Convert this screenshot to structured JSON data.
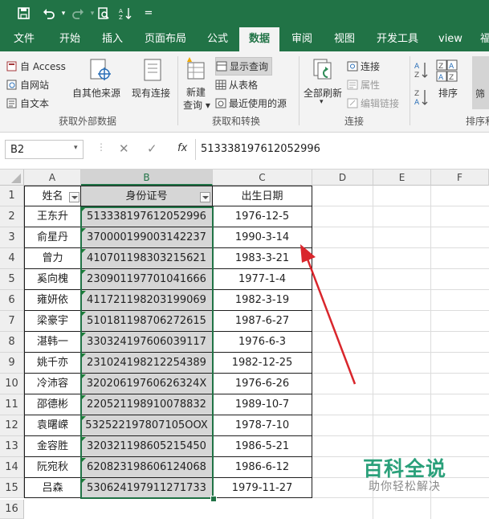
{
  "quick_access": {
    "qa_more": "="
  },
  "tabs": [
    {
      "label": "文件"
    },
    {
      "label": "开始"
    },
    {
      "label": "插入"
    },
    {
      "label": "页面布局"
    },
    {
      "label": "公式"
    },
    {
      "label": "数据"
    },
    {
      "label": "审阅"
    },
    {
      "label": "视图"
    },
    {
      "label": "开发工具"
    },
    {
      "label": "view"
    },
    {
      "label": "福"
    }
  ],
  "active_tab": "数据",
  "ribbon": {
    "get_external": {
      "from_access": "自 Access",
      "from_web": "自网站",
      "from_text": "自文本",
      "from_other": "自其他来源",
      "existing": "现有连接",
      "group_label": "获取外部数据"
    },
    "get_transform": {
      "new_query_1": "新建",
      "new_query_2": "查询",
      "show_queries": "显示查询",
      "from_table": "从表格",
      "recent_sources": "最近使用的源",
      "group_label": "获取和转换"
    },
    "connections": {
      "refresh_all": "全部刷新",
      "connections": "连接",
      "properties": "属性",
      "edit_links": "编辑链接",
      "group_label": "连接"
    },
    "sort_filter": {
      "sort": "排序",
      "filter": "筛",
      "group_label": "排序和"
    }
  },
  "formula_bar": {
    "name_box": "B2",
    "cancel": "✕",
    "enter": "✓",
    "fx": "fx",
    "value": "513338197612052996"
  },
  "columns": [
    "A",
    "B",
    "C",
    "D",
    "E",
    "F"
  ],
  "selected_column": "B",
  "header_row": [
    "姓名",
    "身份证号",
    "出生日期"
  ],
  "rows": [
    {
      "num": "2",
      "name": "王东升",
      "id": "513338197612052996",
      "birth": "1976-12-5"
    },
    {
      "num": "3",
      "name": "俞星丹",
      "id": "370000199003142237",
      "birth": "1990-3-14"
    },
    {
      "num": "4",
      "name": "曾力",
      "id": "410701198303215621",
      "birth": "1983-3-21"
    },
    {
      "num": "5",
      "name": "奚向槐",
      "id": "230901197701041666",
      "birth": "1977-1-4"
    },
    {
      "num": "6",
      "name": "雍妍依",
      "id": "411721198203199069",
      "birth": "1982-3-19"
    },
    {
      "num": "7",
      "name": "梁豪宇",
      "id": "510181198706272615",
      "birth": "1987-6-27"
    },
    {
      "num": "8",
      "name": "湛韩一",
      "id": "330324197606039117",
      "birth": "1976-6-3"
    },
    {
      "num": "9",
      "name": "姚千亦",
      "id": "231024198212254389",
      "birth": "1982-12-25"
    },
    {
      "num": "10",
      "name": "冷沛容",
      "id": "32020619760626324X",
      "birth": "1976-6-26"
    },
    {
      "num": "11",
      "name": "邵德彬",
      "id": "220521198910078832",
      "birth": "1989-10-7"
    },
    {
      "num": "12",
      "name": "袁曙嵘",
      "id": "532522197807105OOX",
      "birth": "1978-7-10"
    },
    {
      "num": "13",
      "name": "金容胜",
      "id": "320321198605215450",
      "birth": "1986-5-21"
    },
    {
      "num": "14",
      "name": "阮宛秋",
      "id": "620823198606124068",
      "birth": "1986-6-12"
    },
    {
      "num": "15",
      "name": "吕森",
      "id": "530624197911271733",
      "birth": "1979-11-27"
    }
  ],
  "row_header_1": "1",
  "row_header_16": "16",
  "watermark": {
    "title": "百科全说",
    "subtitle": "助你轻松解决"
  },
  "colors": {
    "excel_green": "#217346",
    "arrow_red": "#d9262c",
    "watermark_green": "#2aa07a"
  }
}
